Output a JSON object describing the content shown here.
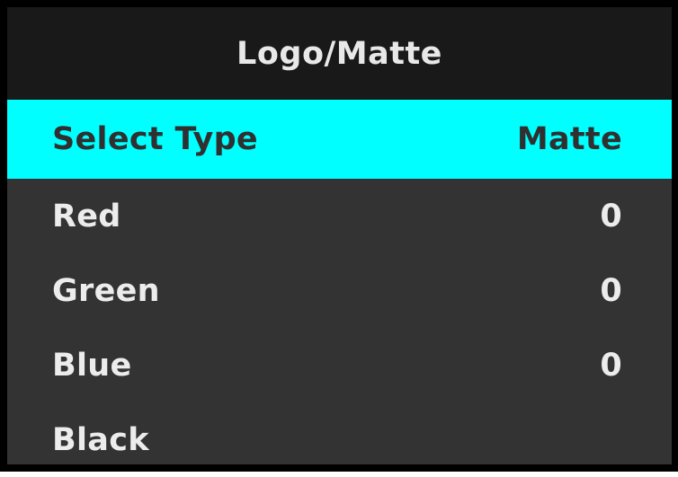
{
  "menu": {
    "title": "Logo/Matte",
    "highlight_color": "#00ffff",
    "items": [
      {
        "label": "Select Type",
        "value": "Matte",
        "selected": true
      },
      {
        "label": "Red",
        "value": "0",
        "selected": false
      },
      {
        "label": "Green",
        "value": "0",
        "selected": false
      },
      {
        "label": "Blue",
        "value": "0",
        "selected": false
      },
      {
        "label": "Black",
        "value": "",
        "selected": false
      }
    ]
  }
}
